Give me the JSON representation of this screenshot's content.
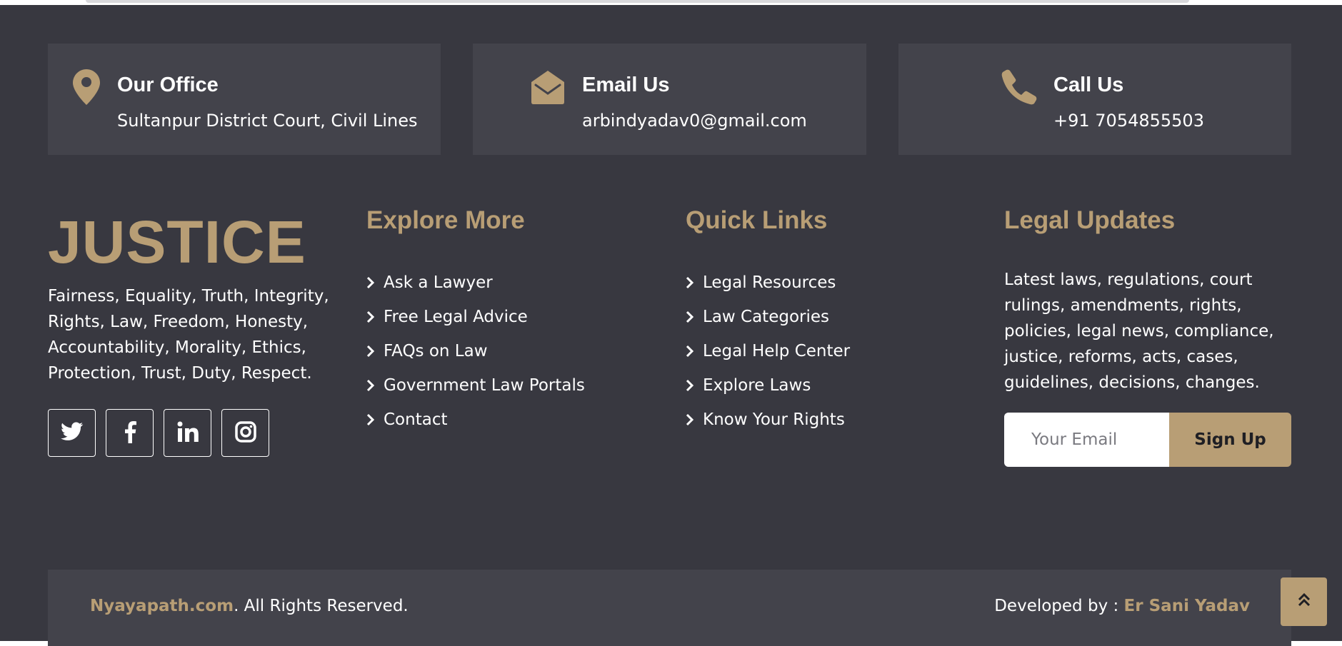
{
  "contact_cards": [
    {
      "title": "Our Office",
      "value": "Sultanpur District Court, Civil Lines",
      "icon": "map-pin-icon"
    },
    {
      "title": "Email Us",
      "value": "arbindyadav0@gmail.com",
      "icon": "envelope-open-icon"
    },
    {
      "title": "Call Us",
      "value": "+91 7054855503",
      "icon": "phone-icon"
    }
  ],
  "brand": {
    "name": "JUSTICE",
    "tagline": "Fairness, Equality, Truth, Integrity, Rights, Law, Freedom, Honesty, Accountability, Morality, Ethics, Protection, Trust, Duty, Respect."
  },
  "social": [
    "twitter-icon",
    "facebook-icon",
    "linkedin-icon",
    "instagram-icon"
  ],
  "explore": {
    "title": "Explore More",
    "links": [
      "Ask a Lawyer",
      "Free Legal Advice",
      "FAQs on Law",
      "Government Law Portals",
      "Contact"
    ]
  },
  "quick": {
    "title": "Quick Links",
    "links": [
      "Legal Resources",
      "Law Categories",
      "Legal Help Center",
      "Explore Laws",
      "Know Your Rights"
    ]
  },
  "updates": {
    "title": "Legal Updates",
    "text": "Latest laws, regulations, court rulings, amendments, rights, policies, legal news, compliance, justice, reforms, acts, cases, guidelines, decisions, changes.",
    "email_placeholder": "Your Email",
    "signup_label": "Sign Up"
  },
  "footer_bar": {
    "site": "Nyayapath.com",
    "rights": ". All Rights Reserved.",
    "developer_prefix": "Developed by : ",
    "developer_name": "Er Sani Yadav"
  },
  "colors": {
    "background": "#383840",
    "card": "#43434b",
    "accent": "#b89e75",
    "text": "#ffffff"
  }
}
